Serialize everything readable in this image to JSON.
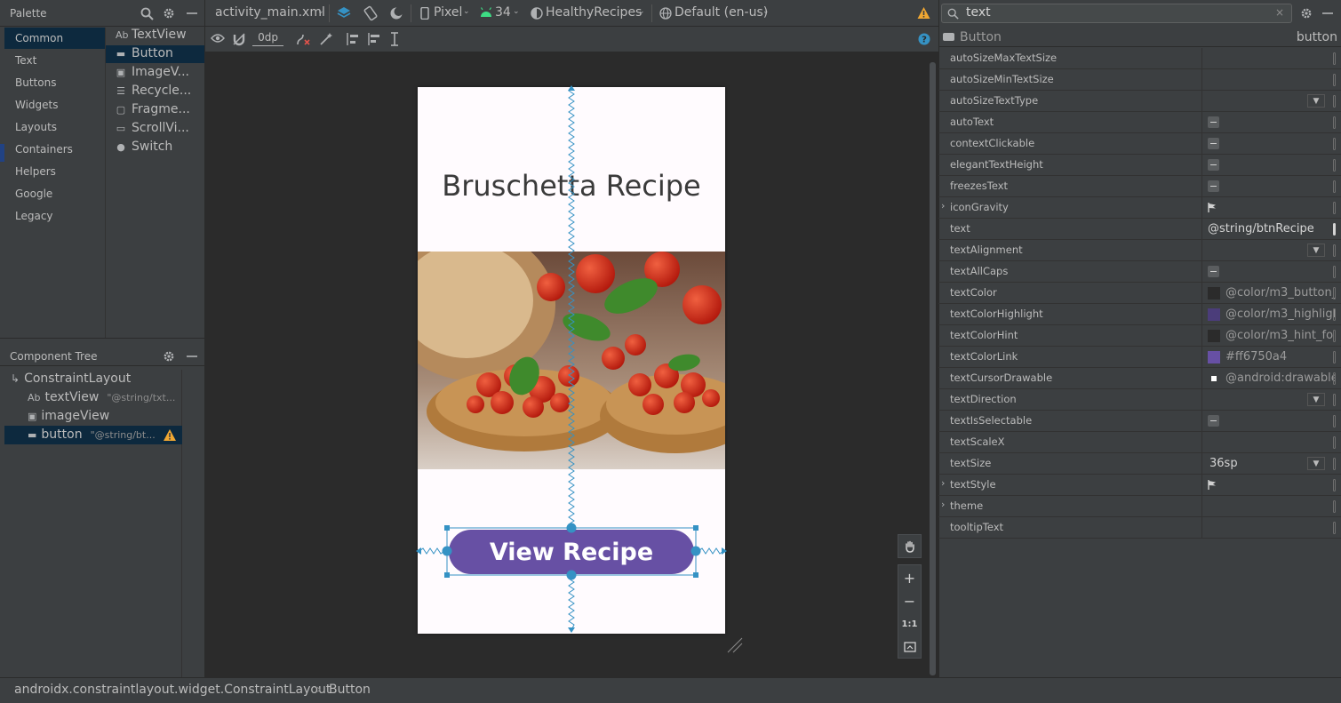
{
  "palette": {
    "title": "Palette",
    "categories": [
      "Common",
      "Text",
      "Buttons",
      "Widgets",
      "Layouts",
      "Containers",
      "Helpers",
      "Google",
      "Legacy"
    ],
    "items": [
      {
        "icon": "Ab",
        "label": "TextView"
      },
      {
        "icon": "▬",
        "label": "Button"
      },
      {
        "icon": "▣",
        "label": "ImageV..."
      },
      {
        "icon": "☰",
        "label": "Recycle..."
      },
      {
        "icon": "▢",
        "label": "Fragme..."
      },
      {
        "icon": "▭",
        "label": "ScrollVi..."
      },
      {
        "icon": "●",
        "label": "Switch"
      }
    ]
  },
  "component_tree": {
    "title": "Component Tree",
    "root": "ConstraintLayout",
    "nodes": [
      {
        "icon": "Ab",
        "label": "textView",
        "hint": "\"@string/txt..."
      },
      {
        "icon": "▣",
        "label": "imageView",
        "hint": ""
      },
      {
        "icon": "▬",
        "label": "button",
        "hint": "\"@string/bt..."
      }
    ]
  },
  "toolbar": {
    "file_tab": "activity_main.xml",
    "device": "Pixel",
    "api": "34",
    "theme": "HealthyRecipes",
    "locale": "Default (en-us)",
    "margin": "0dp"
  },
  "preview": {
    "title_text": "Bruschetta Recipe",
    "button_text": "View Recipe",
    "button_color": "#6750a4"
  },
  "zoom": {
    "fit_label": "1:1"
  },
  "attributes": {
    "search_value": "text",
    "selected_type": "Button",
    "selected_id": "button",
    "rows": [
      {
        "name": "autoSizeMaxTextSize",
        "kind": "empty"
      },
      {
        "name": "autoSizeMinTextSize",
        "kind": "empty"
      },
      {
        "name": "autoSizeTextType",
        "kind": "dropdown",
        "value": ""
      },
      {
        "name": "autoText",
        "kind": "check"
      },
      {
        "name": "contextClickable",
        "kind": "check"
      },
      {
        "name": "elegantTextHeight",
        "kind": "check"
      },
      {
        "name": "freezesText",
        "kind": "check"
      },
      {
        "name": "iconGravity",
        "kind": "flag",
        "expandable": true
      },
      {
        "name": "text",
        "kind": "text",
        "value": "@string/btnRecipe"
      },
      {
        "name": "textAlignment",
        "kind": "dropdown",
        "value": ""
      },
      {
        "name": "textAllCaps",
        "kind": "check"
      },
      {
        "name": "textColor",
        "kind": "color",
        "value": "@color/m3_button_",
        "swatch": "#2b2b2b"
      },
      {
        "name": "textColorHighlight",
        "kind": "color",
        "value": "@color/m3_highligl",
        "swatch": "#4b3d7a"
      },
      {
        "name": "textColorHint",
        "kind": "color",
        "value": "@color/m3_hint_fo",
        "swatch": "#2b2b2b"
      },
      {
        "name": "textColorLink",
        "kind": "color",
        "value": "#ff6750a4",
        "swatch": "#6750a4"
      },
      {
        "name": "textCursorDrawable",
        "kind": "color",
        "value": "@android:drawable",
        "swatch": "#ffffff"
      },
      {
        "name": "textDirection",
        "kind": "dropdown",
        "value": ""
      },
      {
        "name": "textIsSelectable",
        "kind": "check"
      },
      {
        "name": "textScaleX",
        "kind": "empty"
      },
      {
        "name": "textSize",
        "kind": "dropdown",
        "value": "36sp"
      },
      {
        "name": "textStyle",
        "kind": "flag",
        "expandable": true
      },
      {
        "name": "theme",
        "kind": "empty",
        "expandable": true
      },
      {
        "name": "tooltipText",
        "kind": "empty"
      }
    ]
  },
  "status": {
    "path": "androidx.constraintlayout.widget.ConstraintLayout",
    "sep": "›",
    "current": "Button"
  }
}
